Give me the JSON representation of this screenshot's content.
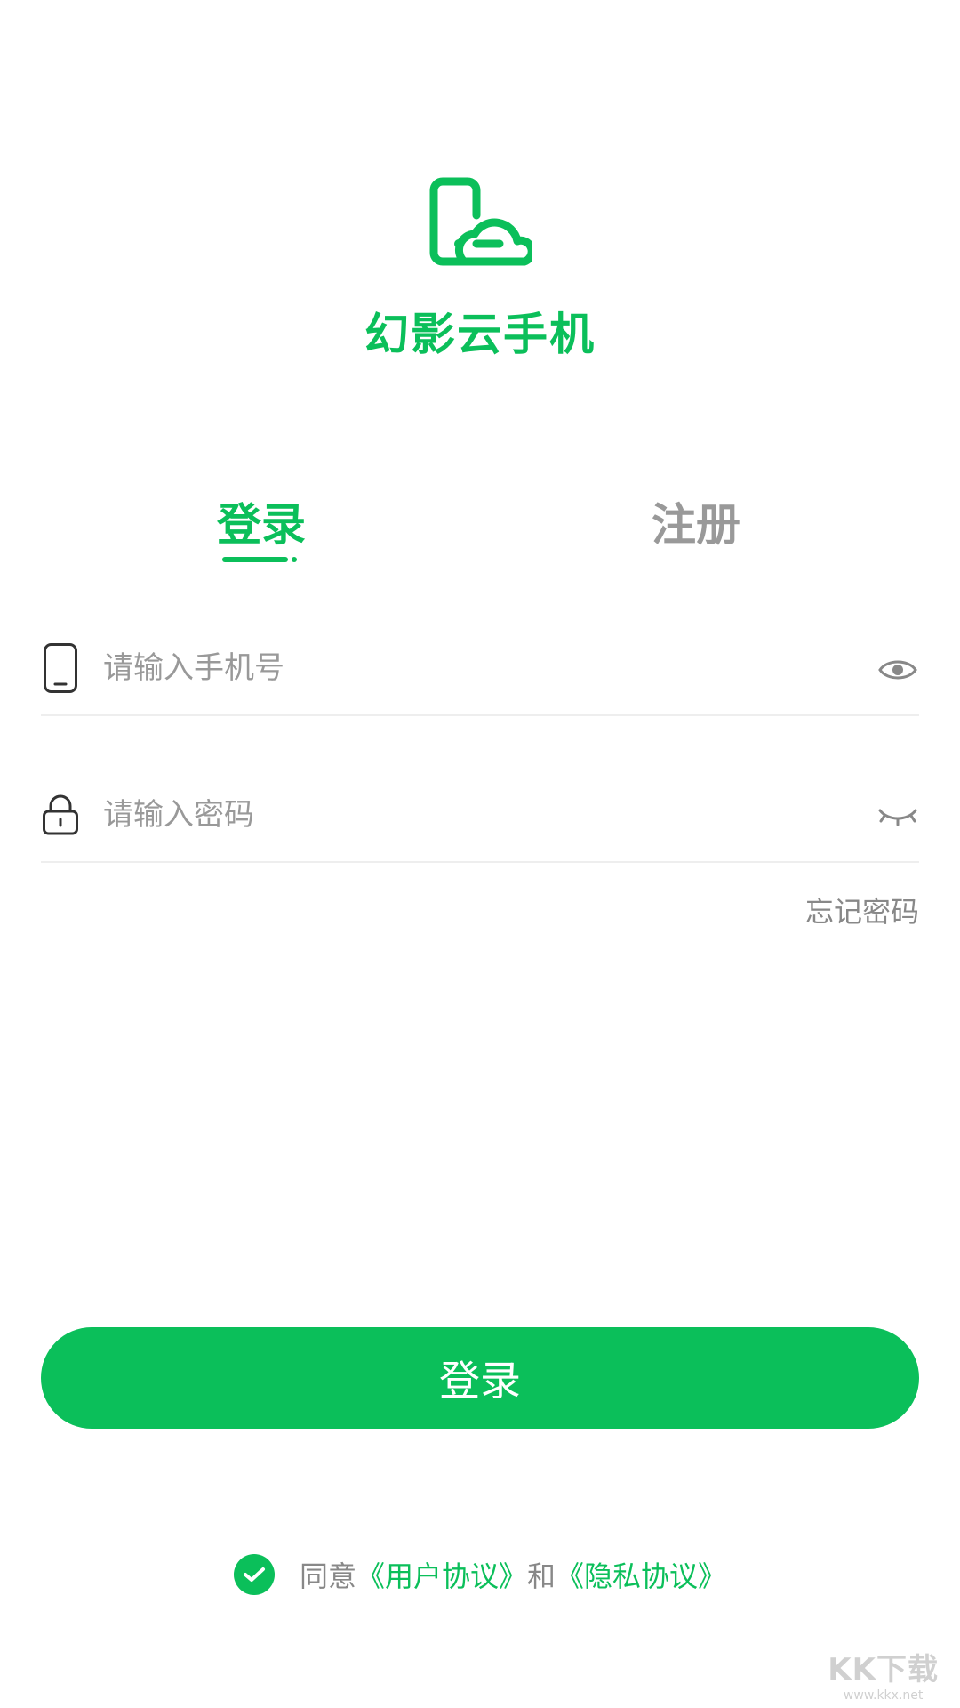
{
  "app": {
    "name": "幻影云手机",
    "logo_icon": "phone-cloud-icon",
    "accent_color": "#0bbf5a"
  },
  "tabs": {
    "login_label": "登录",
    "register_label": "注册",
    "active": "login"
  },
  "form": {
    "phone": {
      "placeholder": "请输入手机号",
      "value": "",
      "lead_icon": "phone-icon",
      "trail_icon": "eye-open-icon"
    },
    "password": {
      "placeholder": "请输入密码",
      "value": "",
      "lead_icon": "lock-icon",
      "trail_icon": "eye-closed-icon"
    },
    "forgot_label": "忘记密码",
    "submit_label": "登录"
  },
  "agreement": {
    "checked": true,
    "prefix": "同意",
    "user_agreement": "《用户协议》",
    "conjunction": "和",
    "privacy_agreement": "《隐私协议》"
  },
  "watermark": {
    "main": "KK下载",
    "sub": "www.kkx.net"
  }
}
